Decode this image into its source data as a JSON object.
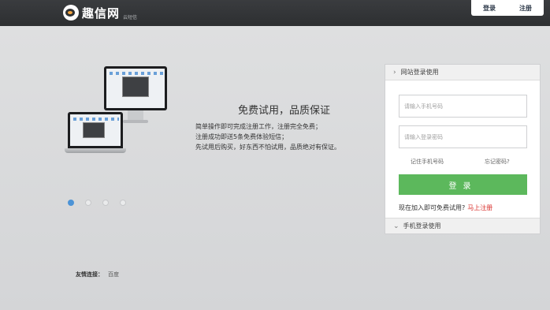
{
  "header": {
    "logo_text": "趣信网",
    "logo_sub": "云短信",
    "login_link": "登录",
    "register_link": "注册"
  },
  "hero": {
    "headline": "免费试用，品质保证",
    "lines": [
      "简单操作即可完成注册工作，注册完全免费；",
      "注册成功即送5条免费体验短信；",
      "先试用后购买，好东西不怕试用，品质绝对有保证。"
    ],
    "carousel_active_index": 0,
    "carousel_count": 4
  },
  "footer": {
    "friend_label": "友情连接：",
    "friend_link": "百度"
  },
  "login_panel": {
    "site_login_title": "网站登录使用",
    "phone_placeholder": "请输入手机号码",
    "password_placeholder": "请输入登录密码",
    "remember_phone": "记住手机号码",
    "forgot_password": "忘记密码?",
    "login_button": "登录",
    "trial_text": "现在加入即可免费试用?",
    "register_now": "马上注册",
    "mobile_login_title": "手机登录使用"
  },
  "colors": {
    "topbar": "#2d2f31",
    "login_button": "#5cb85c",
    "register_now": "#d9302c",
    "carousel_active": "#4c93d6"
  }
}
